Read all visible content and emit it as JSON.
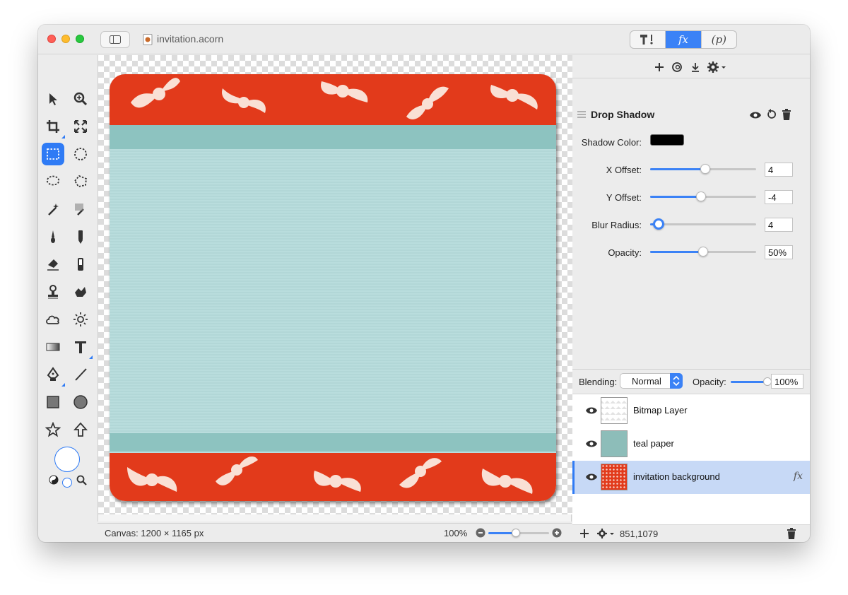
{
  "window": {
    "title": "invitation.acorn",
    "colors": {
      "accent": "#2f7bf5",
      "traffic_red": "#ff5f57",
      "traffic_yellow": "#febc2e",
      "traffic_green": "#28c840"
    }
  },
  "toolbar": {
    "segments": [
      {
        "label": "",
        "icon": "tools-icon"
      },
      {
        "label": "fx",
        "icon": "fx-icon",
        "active": true
      },
      {
        "label": "(p)",
        "icon": "properties-icon"
      }
    ],
    "filter_actions": [
      "plus-icon",
      "stamp-icon",
      "download-icon",
      "gear-icon"
    ]
  },
  "tools": [
    "move-arrow-icon",
    "zoom-icon",
    "crop-icon",
    "transform-icon",
    "rect-select-icon",
    "ellipse-select-icon",
    "lasso-icon",
    "polygon-lasso-icon",
    "magic-wand-icon",
    "color-select-icon",
    "brush-icon",
    "pencil-icon",
    "eraser-icon",
    "clone-icon",
    "stamp-icon",
    "burn-icon",
    "cloud-icon",
    "sun-icon",
    "gradient-icon",
    "text-icon",
    "pen-icon",
    "line-icon",
    "rectangle-icon",
    "circle-icon",
    "star-icon",
    "arrow-up-icon"
  ],
  "filter": {
    "title": "Drop Shadow",
    "shadow_color_label": "Shadow Color:",
    "shadow_color": "#000000",
    "params": [
      {
        "label": "X Offset:",
        "value": "4",
        "level": 0.52
      },
      {
        "label": "Y Offset:",
        "value": "-4",
        "level": 0.48
      },
      {
        "label": "Blur Radius:",
        "value": "4",
        "level": 0.08
      },
      {
        "label": "Opacity:",
        "value": "50%",
        "level": 0.5
      }
    ]
  },
  "layers_panel": {
    "blending_label": "Blending:",
    "blending_value": "Normal",
    "opacity_label": "Opacity:",
    "opacity_value": "100%",
    "opacity_level": 1.0,
    "layers": [
      {
        "name": "Bitmap Layer",
        "visible": true,
        "selected": false,
        "fx": false
      },
      {
        "name": "teal paper",
        "visible": true,
        "selected": false,
        "fx": false
      },
      {
        "name": "invitation background",
        "visible": true,
        "selected": true,
        "fx": true,
        "fx_label": "fx"
      }
    ],
    "cursor_position": "851,1079"
  },
  "status": {
    "canvas_size": "Canvas: 1200 × 1165 px",
    "zoom": "100%",
    "zoom_level": 0.45
  },
  "artwork": {
    "pattern_color": "#e23a1b",
    "paper_color": "#b5dbdb",
    "band_color": "#8dc3c0"
  }
}
